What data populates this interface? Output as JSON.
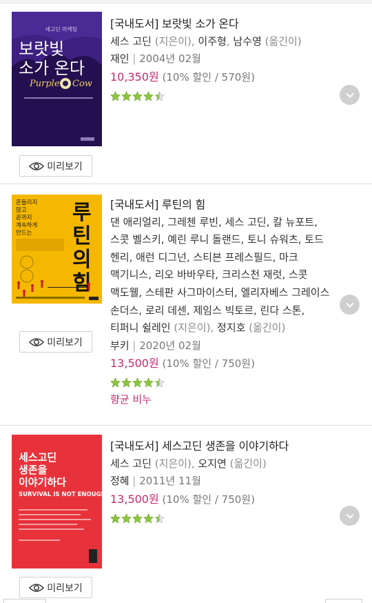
{
  "books": [
    {
      "title": "[국내도서] 보랏빛 소가 온다",
      "authors": [
        {
          "name": "세스 고딘",
          "role": "(지은이)"
        },
        {
          "name": "이주형",
          "role": ""
        },
        {
          "name": "남수영",
          "role": "(옮긴이)"
        }
      ],
      "publisher": "재인",
      "date": "2004년 02월",
      "price": "10,350원",
      "discount": "(10% 할인 / 570원)",
      "rating": 4.5,
      "preview_label": "미리보기",
      "cover": {
        "title": "보랏빛\n소가 온다",
        "kicker": "세고딘 마케팅",
        "subtitle": "Purple Cow",
        "color": "#3d2080"
      }
    },
    {
      "title": "[국내도서] 루틴의 힘",
      "authors_text": "댄 애리얼리, 그레첸 루빈, 세스 고딘, 칼 뉴포트, 스콧 벨스키, 예린 루니 돌랜드, 토니 슈워츠, 토드 헨리, 애런 디그넌, 스티븐 프레스필드, 마크 맥기니스, 리오 바바우타, 크리스천 재럿, 스콧 맥도웰, 스테판 사그마이스터, 엘리자베스 그레이스 손더스, 로리 데센, 제임스 빅토르, 린다 스톤, 티퍼니 쉴레인",
      "author_role": "(지은이),",
      "translator": "정지호",
      "translator_role": "(옮긴이)",
      "publisher": "부키",
      "date": "2020년 02월",
      "price": "13,500원",
      "discount": "(10% 할인 / 750원)",
      "rating": 4.5,
      "tag": "향균 비누",
      "preview_label": "미리보기",
      "cover": {
        "title": "루틴의 힘",
        "kicker": "흔들리지\n않고\n끝까지\n계속하게\n만드는",
        "color": "#f5b800"
      }
    },
    {
      "title": "[국내도서] 세스고딘 생존을 이야기하다",
      "authors": [
        {
          "name": "세스 고딘",
          "role": "(지은이),"
        },
        {
          "name": "오지연",
          "role": "(옮긴이)"
        }
      ],
      "publisher": "정혜",
      "date": "2011년 11월",
      "price": "13,500원",
      "discount": "(10% 할인 / 750원)",
      "rating": 4.5,
      "preview_label": "미리보기",
      "cover": {
        "title": "세스고딘\n생존을\n이야기하다",
        "subtitle": "SURVIVAL IS NOT ENOUGH",
        "color": "#e8323b"
      }
    }
  ],
  "colors": {
    "price": "#c72b6f",
    "star": "#8cc63f",
    "chevron_bg": "#cfcfcf"
  }
}
